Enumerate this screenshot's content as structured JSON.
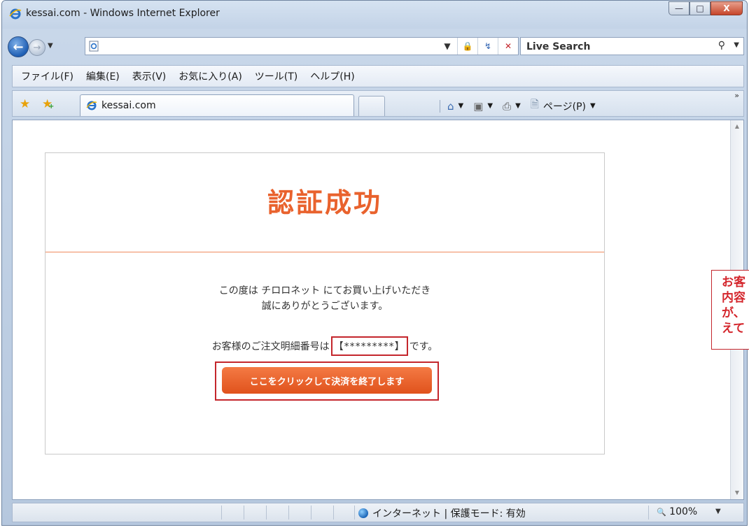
{
  "window": {
    "title": "kessai.com - Windows Internet Explorer",
    "controls": {
      "minimize": "—",
      "maximize": "□",
      "close": "X"
    }
  },
  "nav": {
    "address_value": "",
    "address_tools": [
      "▼",
      "🔒",
      "↯",
      "✕"
    ],
    "search_placeholder": "Live Search",
    "search_icon": "search-icon",
    "search_glyph": "⚲"
  },
  "menu": {
    "items": [
      "ファイル(F)",
      "編集(E)",
      "表示(V)",
      "お気に入り(A)",
      "ツール(T)",
      "ヘルプ(H)"
    ]
  },
  "tabs": {
    "active_label": "kessai.com",
    "commands": {
      "home": "⌂",
      "feeds": "▣",
      "print": "⎙",
      "page_label": "ページ(P)"
    },
    "more": "»"
  },
  "page": {
    "title": "認証成功",
    "thanks_lines": [
      "この度は チロロネット にてお買い上げいただき",
      "誠にありがとうございます。"
    ],
    "order_prefix": "お客様のご注文明細番号は",
    "order_number": "【*********】",
    "order_suffix": "です。",
    "finish_button": "ここをクリックして決済を終了します"
  },
  "status": {
    "zone": "インターネット | 保護モード: 有効",
    "zoom": "100%",
    "zoom_icon": "🔍"
  },
  "callout": {
    "text": "お客\n内容\nが、\nえて"
  },
  "colors": {
    "accent": "#e9622d",
    "highlight_border": "#c4262c"
  }
}
